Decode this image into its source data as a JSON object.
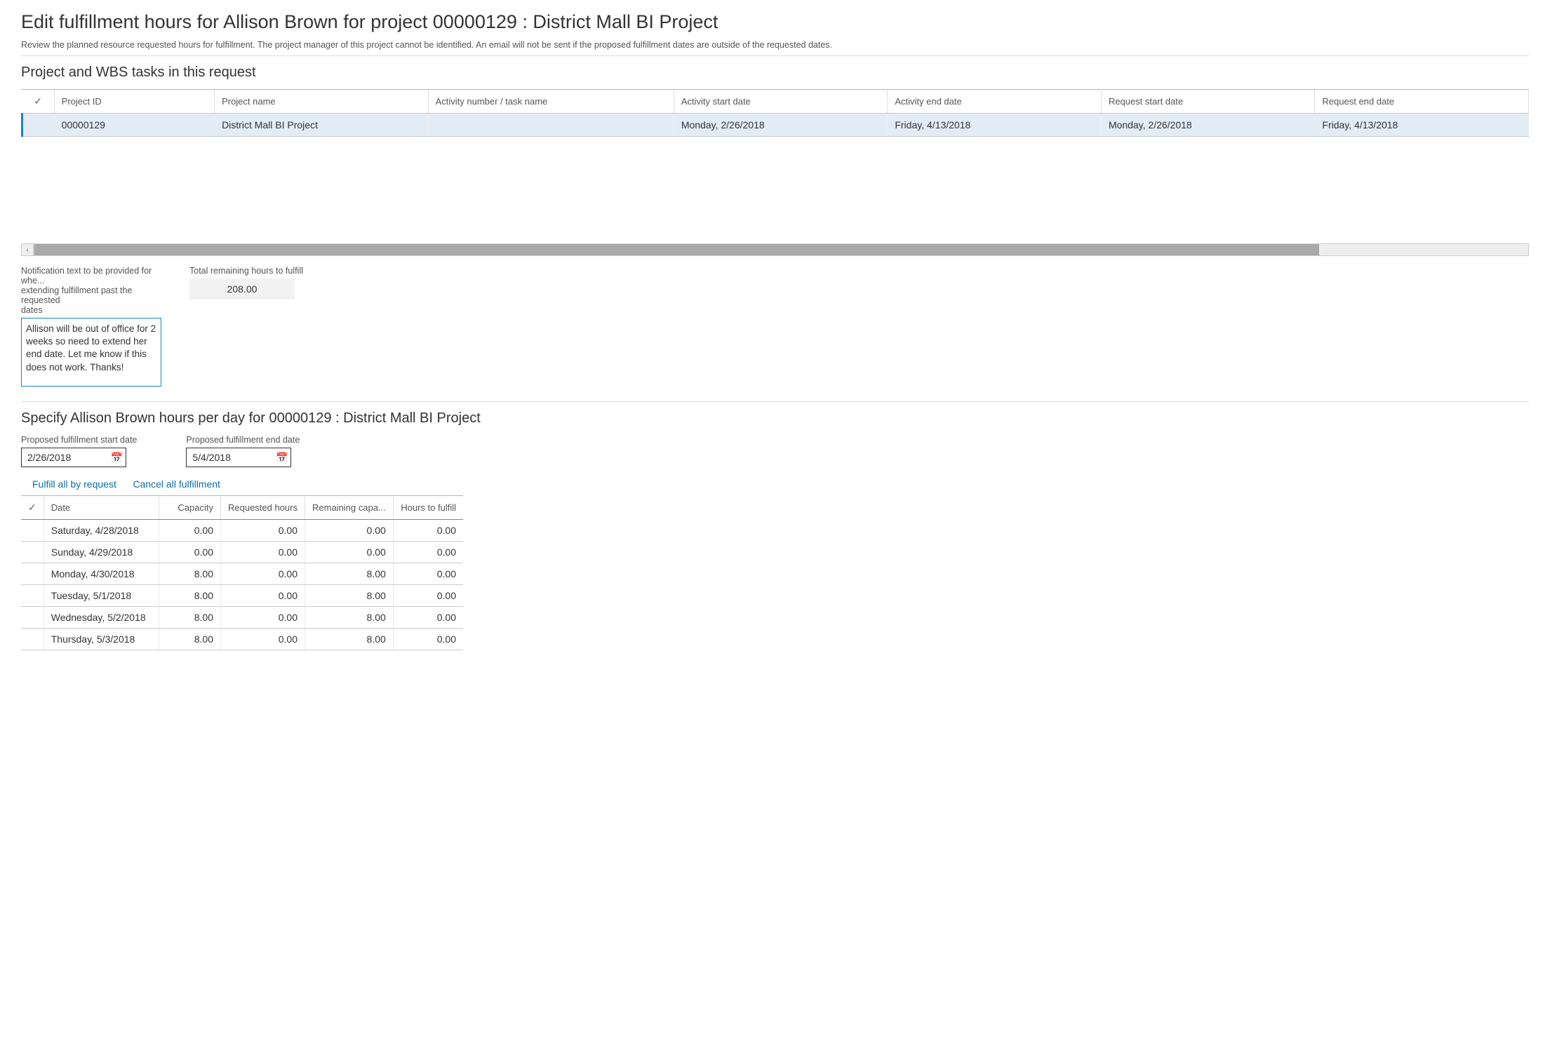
{
  "page": {
    "title": "Edit fulfillment hours for Allison Brown for project 00000129 : District Mall BI Project",
    "description": "Review the planned resource requested hours for fulfillment. The project manager of this project cannot be identified. An email will not be sent if the proposed fulfillment dates are outside of the requested dates."
  },
  "section1": {
    "title": "Project and WBS tasks in this request",
    "columns": {
      "project_id": "Project ID",
      "project_name": "Project name",
      "activity_task": "Activity number / task name",
      "activity_start": "Activity start date",
      "activity_end": "Activity end date",
      "request_start": "Request start date",
      "request_end": "Request end date"
    },
    "row": {
      "project_id": "00000129",
      "project_name": "District Mall BI Project",
      "activity_task": "",
      "activity_start": "Monday, 2/26/2018",
      "activity_end": "Friday, 4/13/2018",
      "request_start": "Monday, 2/26/2018",
      "request_end": "Friday, 4/13/2018"
    }
  },
  "notification": {
    "label_l1": "Notification text to be provided for whe...",
    "label_l2": "extending fulfillment past the requested",
    "label_l3": "dates",
    "text": "Allison will be out of office for 2 weeks so need to extend her end date. Let me know if this does not work. Thanks!"
  },
  "remaining": {
    "label": "Total remaining hours to fulfill",
    "value": "208.00"
  },
  "section2": {
    "title": "Specify Allison Brown hours per day for 00000129 : District Mall BI Project",
    "start_label": "Proposed fulfillment start date",
    "start_value": "2/26/2018",
    "end_label": "Proposed fulfillment end date",
    "end_value": "5/4/2018",
    "link_fulfill": "Fulfill all by request",
    "link_cancel": "Cancel all fulfillment",
    "columns": {
      "date": "Date",
      "capacity": "Capacity",
      "requested": "Requested hours",
      "remaining": "Remaining capa...",
      "tofulfill": "Hours to fulfill"
    },
    "rows": [
      {
        "date": "Saturday, 4/28/2018",
        "capacity": "0.00",
        "requested": "0.00",
        "remaining": "0.00",
        "tofulfill": "0.00"
      },
      {
        "date": "Sunday, 4/29/2018",
        "capacity": "0.00",
        "requested": "0.00",
        "remaining": "0.00",
        "tofulfill": "0.00"
      },
      {
        "date": "Monday, 4/30/2018",
        "capacity": "8.00",
        "requested": "0.00",
        "remaining": "8.00",
        "tofulfill": "0.00"
      },
      {
        "date": "Tuesday, 5/1/2018",
        "capacity": "8.00",
        "requested": "0.00",
        "remaining": "8.00",
        "tofulfill": "0.00"
      },
      {
        "date": "Wednesday, 5/2/2018",
        "capacity": "8.00",
        "requested": "0.00",
        "remaining": "8.00",
        "tofulfill": "0.00"
      },
      {
        "date": "Thursday, 5/3/2018",
        "capacity": "8.00",
        "requested": "0.00",
        "remaining": "8.00",
        "tofulfill": "0.00"
      }
    ]
  }
}
